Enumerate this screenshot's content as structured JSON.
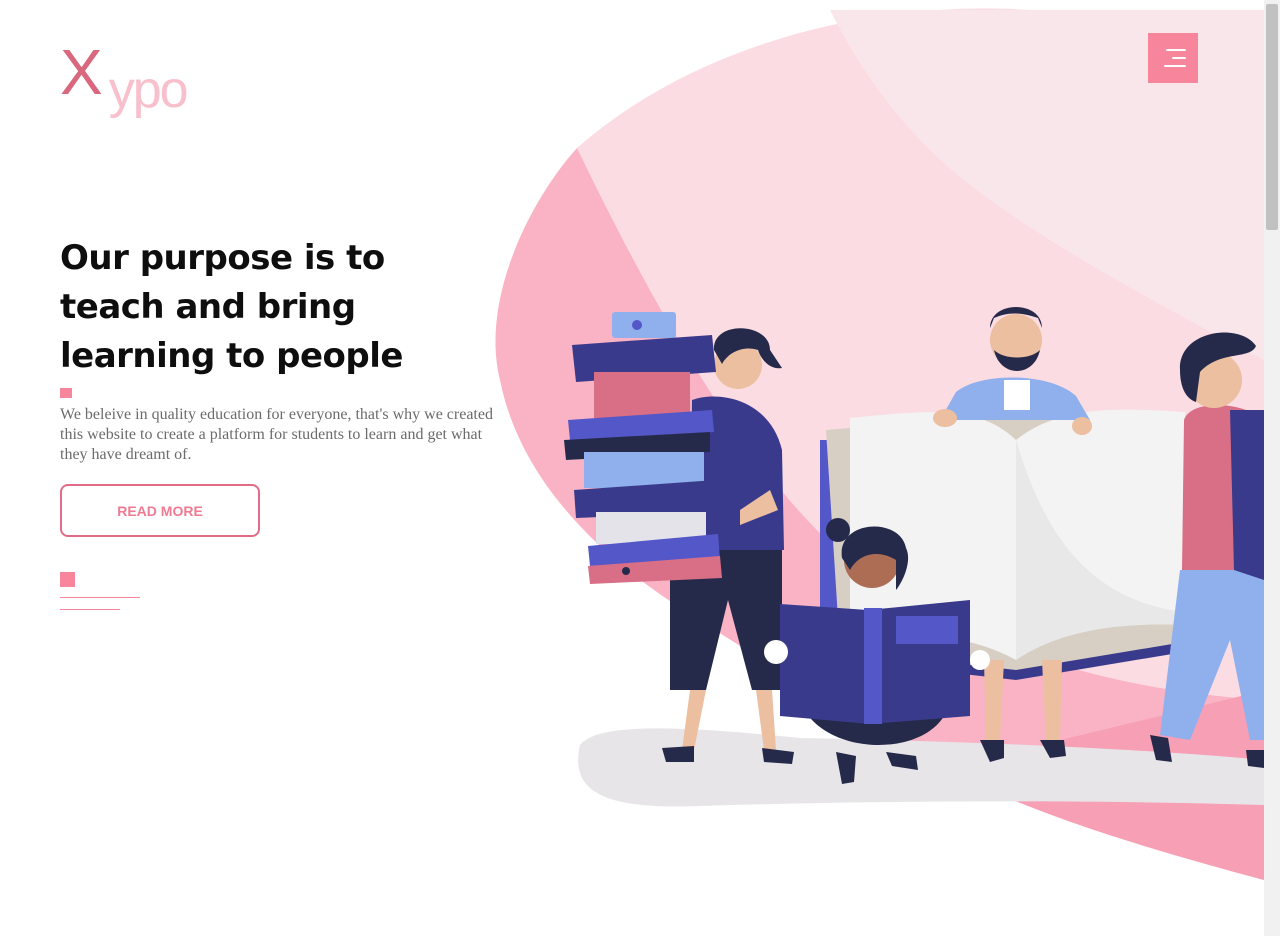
{
  "logo": {
    "letter": "X",
    "rest": "ypo"
  },
  "menu": {
    "icon": "hamburger-menu-icon"
  },
  "hero": {
    "title": "Our purpose is to teach and bring learning to people",
    "description": "We beleive in quality education for everyone, that's why we created this website to create a platform for students to learn and get what they have dreamt of.",
    "read_more_label": "READ MORE"
  },
  "colors": {
    "accent": "#f7859c",
    "logo_x": "#d9677e",
    "logo_rest": "#f8c0cc",
    "blob_light": "#fcd9e0",
    "blob_mid": "#f9b3c3",
    "book_blue": "#3a3a8c",
    "book_violet": "#5457c8"
  },
  "illustration": {
    "name": "people-reading-books-illustration"
  }
}
